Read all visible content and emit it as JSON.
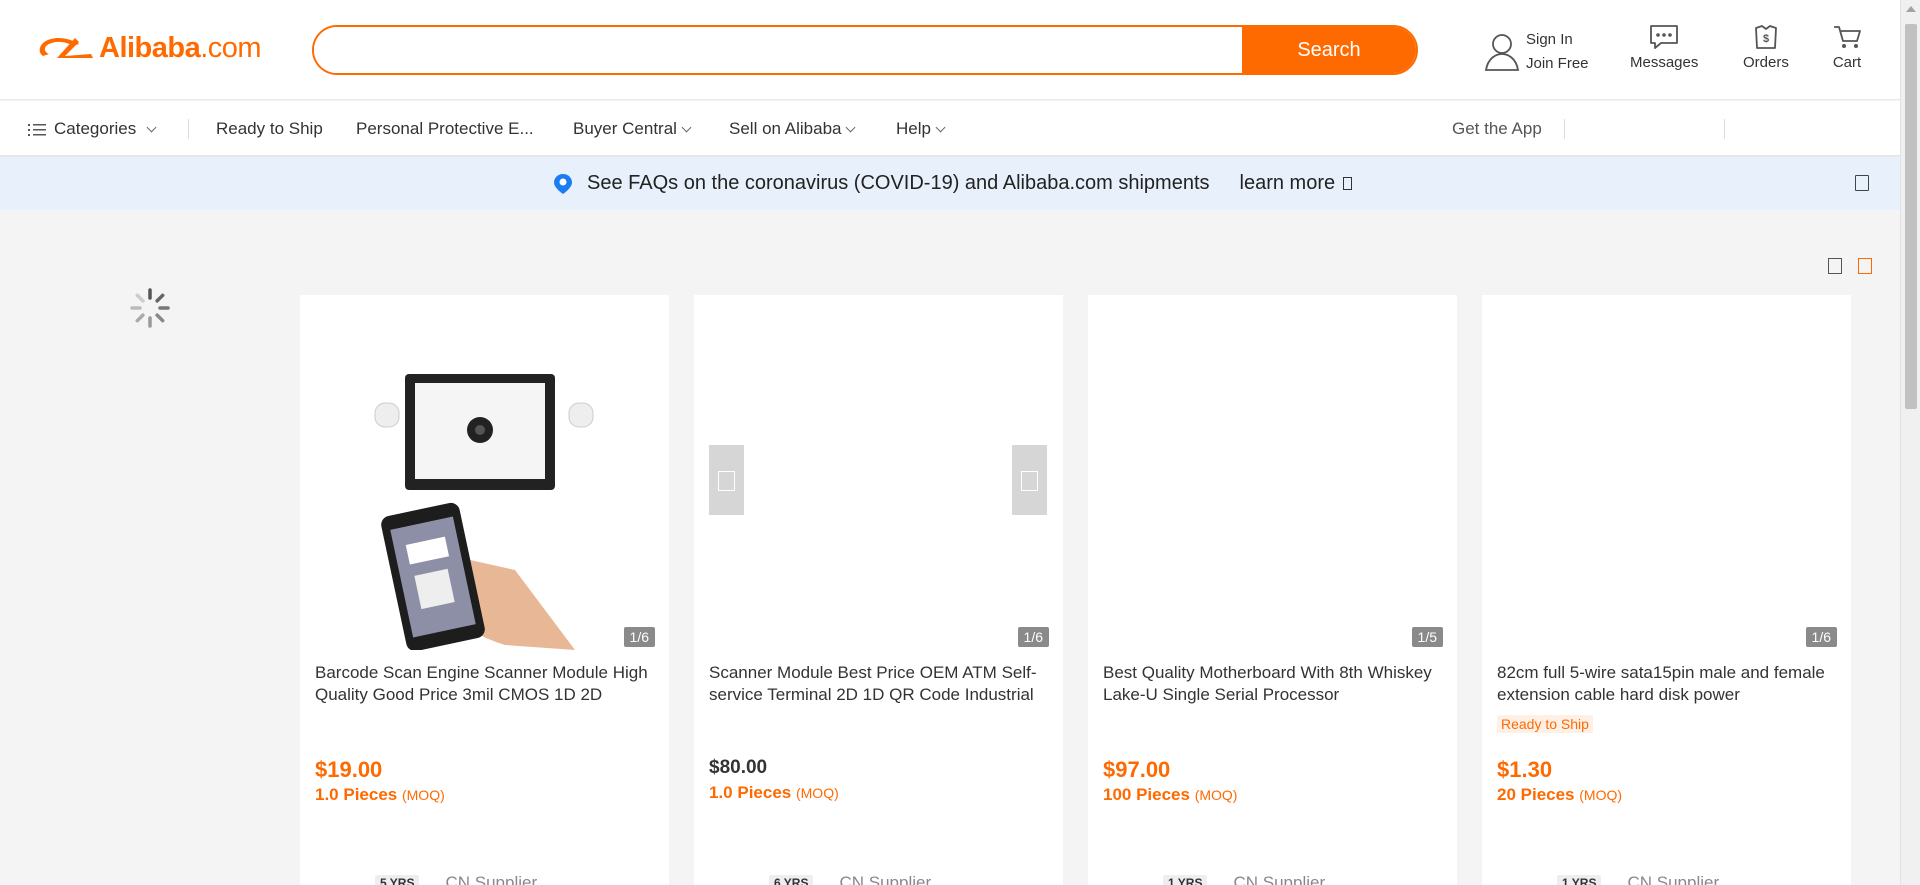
{
  "header": {
    "logo_text": "Alibaba",
    "logo_suffix": ".com",
    "search": {
      "value": "",
      "placeholder": ""
    },
    "search_button": "Search",
    "sign_in": "Sign In",
    "join_free": "Join Free",
    "messages": "Messages",
    "orders": "Orders",
    "cart": "Cart"
  },
  "nav": {
    "categories": "Categories",
    "ready_to_ship": "Ready to Ship",
    "ppe": "Personal Protective E...",
    "buyer_central": "Buyer Central",
    "sell": "Sell on Alibaba",
    "help": "Help",
    "get_app": "Get the App"
  },
  "notice": {
    "text": "See FAQs on the coronavirus (COVID-19) and Alibaba.com shipments",
    "link": "learn more"
  },
  "products": [
    {
      "title": "Barcode Scan Engine Scanner Module High Quality Good Price 3mil CMOS 1D 2D",
      "counter": "1/6",
      "price": "$19.00",
      "moq_qty": "1.0 Pieces",
      "moq_tag": "(MOQ)",
      "years": "5 YRS",
      "supplier": "CN  Supplier"
    },
    {
      "title": "Scanner Module Best Price OEM ATM Self-service Terminal 2D 1D QR Code Industrial",
      "counter": "1/6",
      "price": "$80.00",
      "moq_qty": "1.0 Pieces",
      "moq_tag": "(MOQ)",
      "years": "6 YRS",
      "supplier": "CN  Supplier"
    },
    {
      "title": "Best Quality Motherboard With 8th Whiskey Lake-U Single Serial Processor",
      "counter": "1/5",
      "price": "$97.00",
      "moq_qty": "100 Pieces",
      "moq_tag": "(MOQ)",
      "years": "1 YRS",
      "supplier": "CN  Supplier"
    },
    {
      "title": "82cm full 5-wire sata15pin male and female extension cable hard disk power",
      "counter": "1/6",
      "badge": "Ready to Ship",
      "price": "$1.30",
      "moq_qty": "20 Pieces",
      "moq_tag": "(MOQ)",
      "years": "1 YRS",
      "supplier": "CN  Supplier"
    }
  ],
  "colors": {
    "brand": "#ff6a00",
    "notice_bg": "#e8f1fb",
    "page_bg": "#f4f4f4"
  },
  "icons": [
    "alibaba-logo-icon",
    "user-icon",
    "messages-icon",
    "orders-icon",
    "cart-icon",
    "menu-icon",
    "location-pin-icon",
    "loading-spinner-icon"
  ]
}
